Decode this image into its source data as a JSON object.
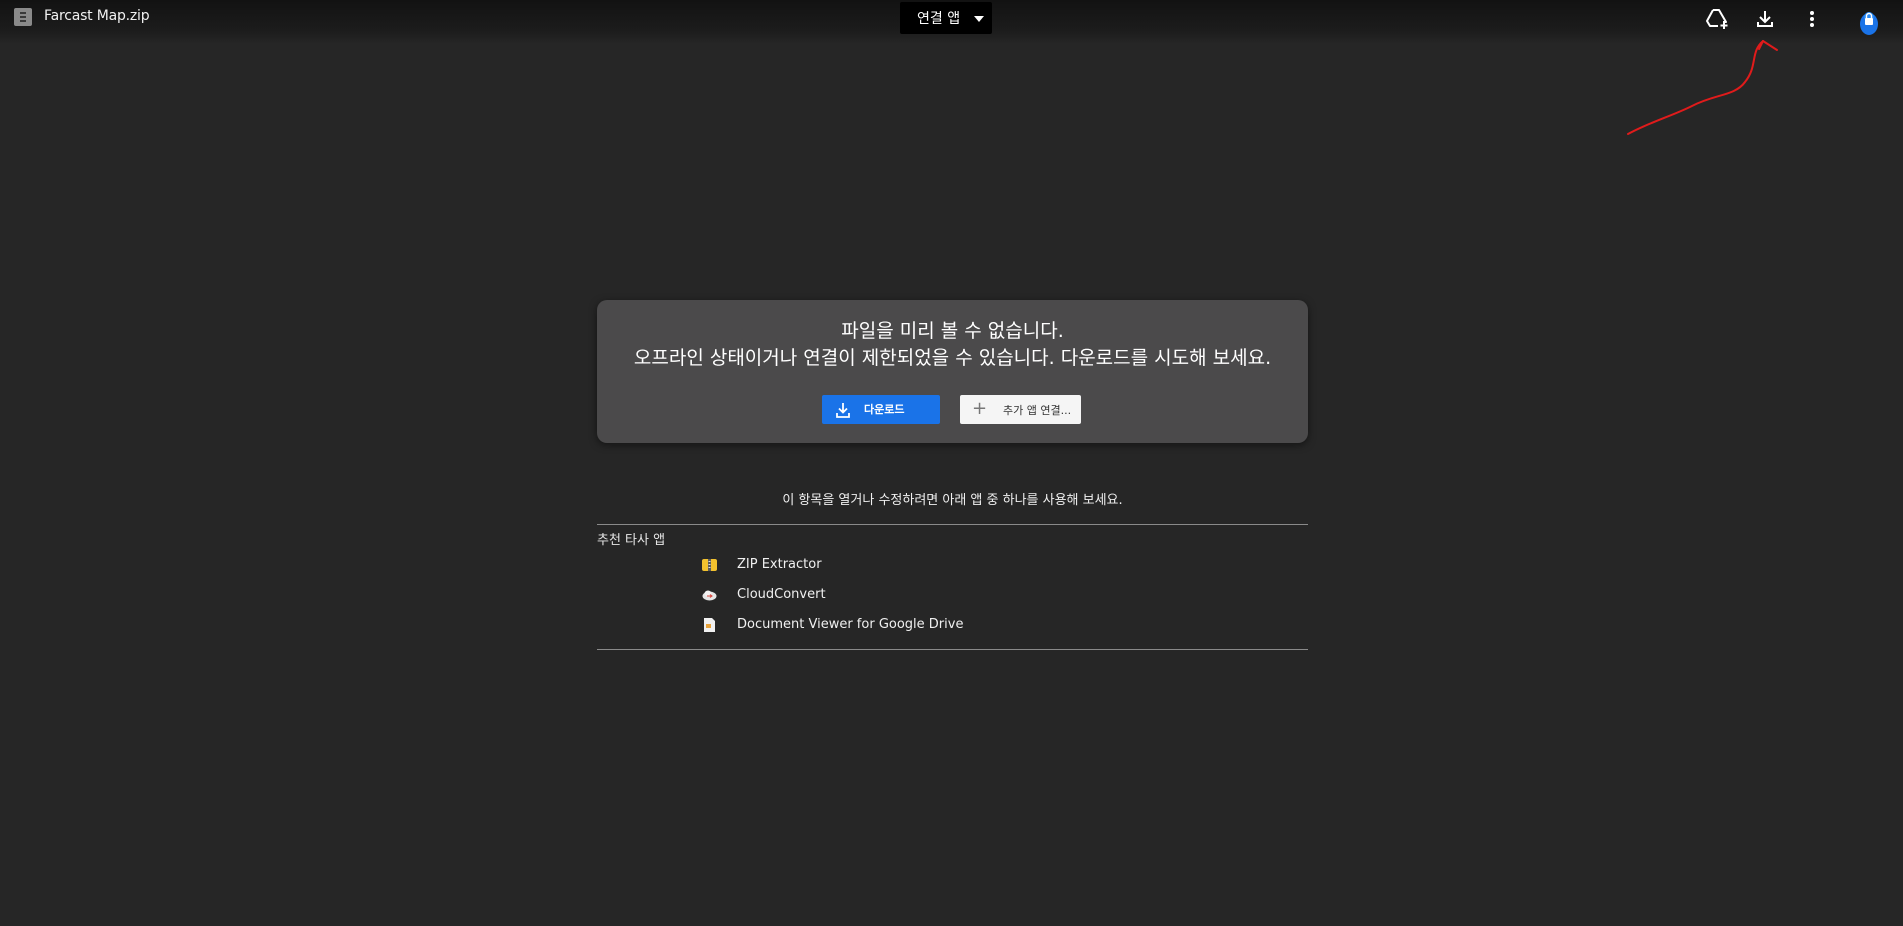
{
  "header": {
    "file_name": "Farcast Map.zip",
    "open_with_label": "연결 앱",
    "icons": [
      "add-to-drive-icon",
      "download-icon",
      "more-options-icon",
      "account-avatar-icon"
    ]
  },
  "preview_card": {
    "line1": "파일을 미리 볼 수 없습니다.",
    "line2": "오프라인 상태이거나 연결이 제한되었을 수 있습니다. 다운로드를 시도해 보세요.",
    "download_label": "다운로드",
    "more_apps_label": "추가 앱 연결..."
  },
  "hint_text": "이 항목을 열거나 수정하려면 아래 앱 중 하나를 사용해 보세요.",
  "suggested": {
    "title": "추천 타사 앱",
    "apps": [
      {
        "name": "ZIP Extractor",
        "icon": "zip-extractor-icon"
      },
      {
        "name": "CloudConvert",
        "icon": "cloudconvert-icon"
      },
      {
        "name": "Document Viewer for Google Drive",
        "icon": "document-viewer-icon"
      }
    ]
  },
  "colors": {
    "background": "#262626",
    "card": "#4b4a4b",
    "primary_button": "#1a73e8",
    "annotation_arrow": "#e01b1b"
  }
}
